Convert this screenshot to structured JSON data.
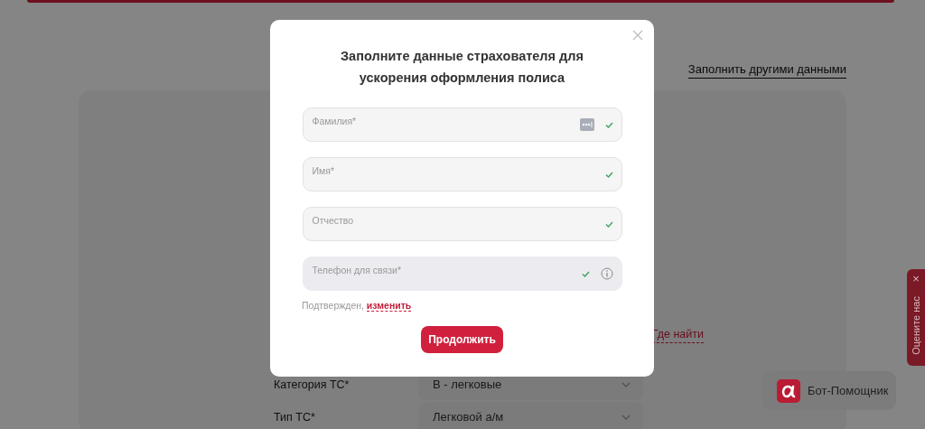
{
  "page": {
    "fill_other_link": "Заполнить другими данными",
    "where_link": "Где найти",
    "vehicle_rows": [
      {
        "label": "Категория ТС*",
        "value": "В - легковые"
      },
      {
        "label": "Тип ТС*",
        "value": "Легковой а/м"
      }
    ]
  },
  "feedback_tab": {
    "label": "Оцените нас",
    "close": "×"
  },
  "bot_button": {
    "label": "Бот-Помощник"
  },
  "modal": {
    "title": "Заполните данные страхователя для ускорения оформления полиса",
    "fields": [
      {
        "kind": "autofill",
        "label": "Фамилия*",
        "valid": true,
        "disabled": false
      },
      {
        "kind": "text",
        "label": "Имя*",
        "valid": true,
        "disabled": false
      },
      {
        "kind": "text",
        "label": "Отчество",
        "valid": true,
        "disabled": false
      },
      {
        "kind": "phone",
        "label": "Телефон для связи*",
        "valid": true,
        "disabled": true
      }
    ],
    "confirm_text": "Подтвержден,",
    "change_link": "изменить",
    "submit": "Продолжить"
  }
}
